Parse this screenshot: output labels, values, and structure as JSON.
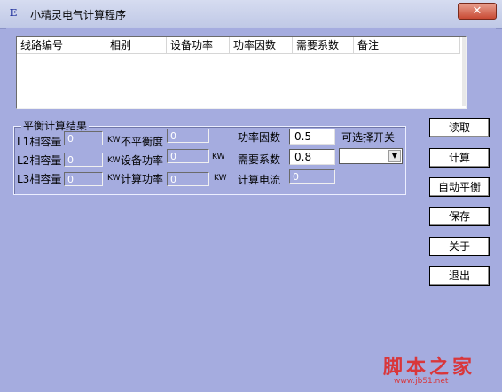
{
  "window": {
    "title": "小精灵电气计算程序",
    "icon_glyph": "E",
    "close_glyph": "✕"
  },
  "list": {
    "columns": [
      "线路编号",
      "相别",
      "设备功率",
      "功率因数",
      "需要系数",
      "备注"
    ]
  },
  "group": {
    "title": "平衡计算结果",
    "l1_label": "L1相容量",
    "l1_value": "0",
    "l2_label": "L2相容量",
    "l2_value": "0",
    "l3_label": "L3相容量",
    "l3_value": "0",
    "unit": "KW",
    "imbalance_label": "不平衡度",
    "imbalance_value": "0",
    "device_power_label": "设备功率",
    "device_power_value": "0",
    "calc_power_label": "计算功率",
    "calc_power_value": "0",
    "power_factor_label": "功率因数",
    "power_factor_value": "0.5",
    "demand_coef_label": "需要系数",
    "demand_coef_value": "0.8",
    "switch_label": "可选择开关",
    "calc_current_label": "计算电流",
    "calc_current_value": "0"
  },
  "buttons": {
    "read": "读取",
    "calc": "计算",
    "auto_balance": "自动平衡",
    "save": "保存",
    "about": "关于",
    "exit": "退出"
  },
  "watermark": {
    "text": "脚本之家",
    "url": "www.jb51.net"
  },
  "colors": {
    "background": "#a5acdf",
    "close": "#c84a34",
    "watermark": "#d9363a"
  }
}
